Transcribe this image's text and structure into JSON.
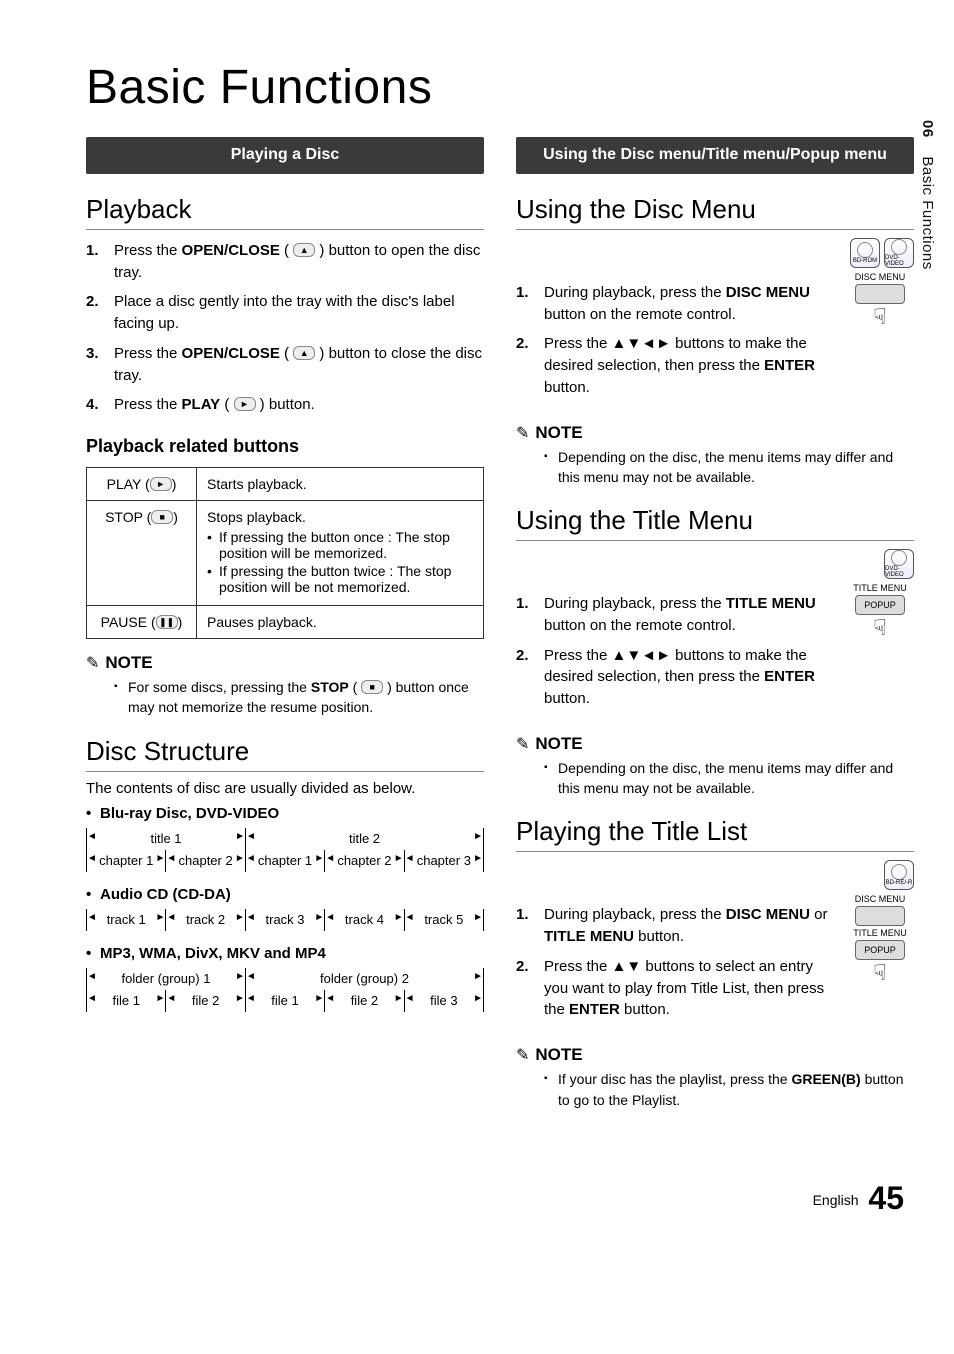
{
  "side_tab": {
    "num": "06",
    "label": "Basic Functions"
  },
  "page_title": "Basic Functions",
  "left": {
    "bar": "Playing a Disc",
    "h_playback": "Playback",
    "steps_playback": [
      {
        "pre": "Press the ",
        "bold": "OPEN/CLOSE",
        "post": " ( ",
        "glyph": "▲",
        "tail": " ) button to open the disc tray."
      },
      {
        "pre": "Place a disc gently into the tray with the disc's label facing up.",
        "glyph": "",
        "bold": "",
        "post": "",
        "tail": ""
      },
      {
        "pre": "Press the ",
        "bold": "OPEN/CLOSE",
        "post": " ( ",
        "glyph": "▲",
        "tail": " ) button to close the disc tray."
      },
      {
        "pre": "Press the ",
        "bold": "PLAY",
        "post": " ( ",
        "glyph": "►",
        "tail": " ) button."
      }
    ],
    "h_related": "Playback related buttons",
    "table": {
      "play_label": "PLAY (",
      "play_glyph": "►",
      "play_desc": "Starts playback.",
      "stop_label": "STOP (",
      "stop_glyph": "■",
      "stop_desc_head": "Stops playback.",
      "stop_b1": "If pressing the button once : The stop position will be memorized.",
      "stop_b2": "If pressing the button twice : The stop position will be not memorized.",
      "pause_label": "PAUSE (",
      "pause_glyph": "❚❚",
      "pause_desc": "Pauses playback."
    },
    "note_label": "NOTE",
    "note1_pre": "For some discs, pressing the ",
    "note1_bold": "STOP",
    "note1_post": " ( ",
    "note1_glyph": "■",
    "note1_tail": " ) button once may not memorize the resume position.",
    "h_struct": "Disc Structure",
    "struct_intro": "The contents of disc are usually divided as below.",
    "bd_head": "Blu-ray Disc, DVD-VIDEO",
    "bd_top": [
      "title 1",
      "title 2"
    ],
    "bd_bot": [
      "chapter 1",
      "chapter 2",
      "chapter 1",
      "chapter 2",
      "chapter 3"
    ],
    "cd_head": "Audio CD (CD-DA)",
    "cd_row": [
      "track 1",
      "track 2",
      "track 3",
      "track 4",
      "track 5"
    ],
    "mp_head": "MP3, WMA, DivX, MKV and MP4",
    "mp_top": [
      "folder (group) 1",
      "folder (group) 2"
    ],
    "mp_bot": [
      "file 1",
      "file 2",
      "file 1",
      "file 2",
      "file 3"
    ]
  },
  "right": {
    "bar": "Using the Disc menu/Title menu/Popup menu",
    "h_disc": "Using the Disc Menu",
    "badges_disc": [
      "BD-ROM",
      "DVD-VIDEO"
    ],
    "remote_disc": "DISC MENU",
    "steps_disc": [
      {
        "pre": "During playback, press the ",
        "bold": "DISC MENU",
        "tail": " button on the remote control."
      },
      {
        "pre": "Press the ▲▼◄► buttons to make the desired selection, then press the ",
        "bold": "ENTER",
        "tail": " button."
      }
    ],
    "note_label": "NOTE",
    "note_disc": "Depending on the disc, the menu items may differ and this menu may not be available.",
    "h_title": "Using the Title Menu",
    "badges_title": [
      "DVD-VIDEO"
    ],
    "remote_title_top": "TITLE MENU",
    "remote_title_bot": "POPUP",
    "steps_title": [
      {
        "pre": "During playback, press the ",
        "bold": "TITLE MENU",
        "tail": " button on the remote control."
      },
      {
        "pre": "Press the ▲▼◄► buttons to make the desired selection, then press the ",
        "bold": "ENTER",
        "tail": " button."
      }
    ],
    "note_title": "Depending on the disc, the menu items may differ and this menu may not be available.",
    "h_list": "Playing the Title List",
    "badges_list": [
      "BD-RE/-R"
    ],
    "remote_list_a": "DISC MENU",
    "remote_list_b": "TITLE MENU",
    "remote_list_c": "POPUP",
    "steps_list": [
      {
        "pre": "During playback, press the ",
        "bold": "DISC MENU",
        "mid": " or ",
        "bold2": "TITLE MENU",
        "tail": " button."
      },
      {
        "pre": "Press the ▲▼ buttons to select an entry you want to play from Title List, then press the ",
        "bold": "ENTER",
        "tail": " button."
      }
    ],
    "note_list_pre": "If your disc has the playlist, press the ",
    "note_list_bold": "GREEN(B)",
    "note_list_tail": " button to go to the Playlist."
  },
  "footer": {
    "lang": "English",
    "page": "45"
  }
}
